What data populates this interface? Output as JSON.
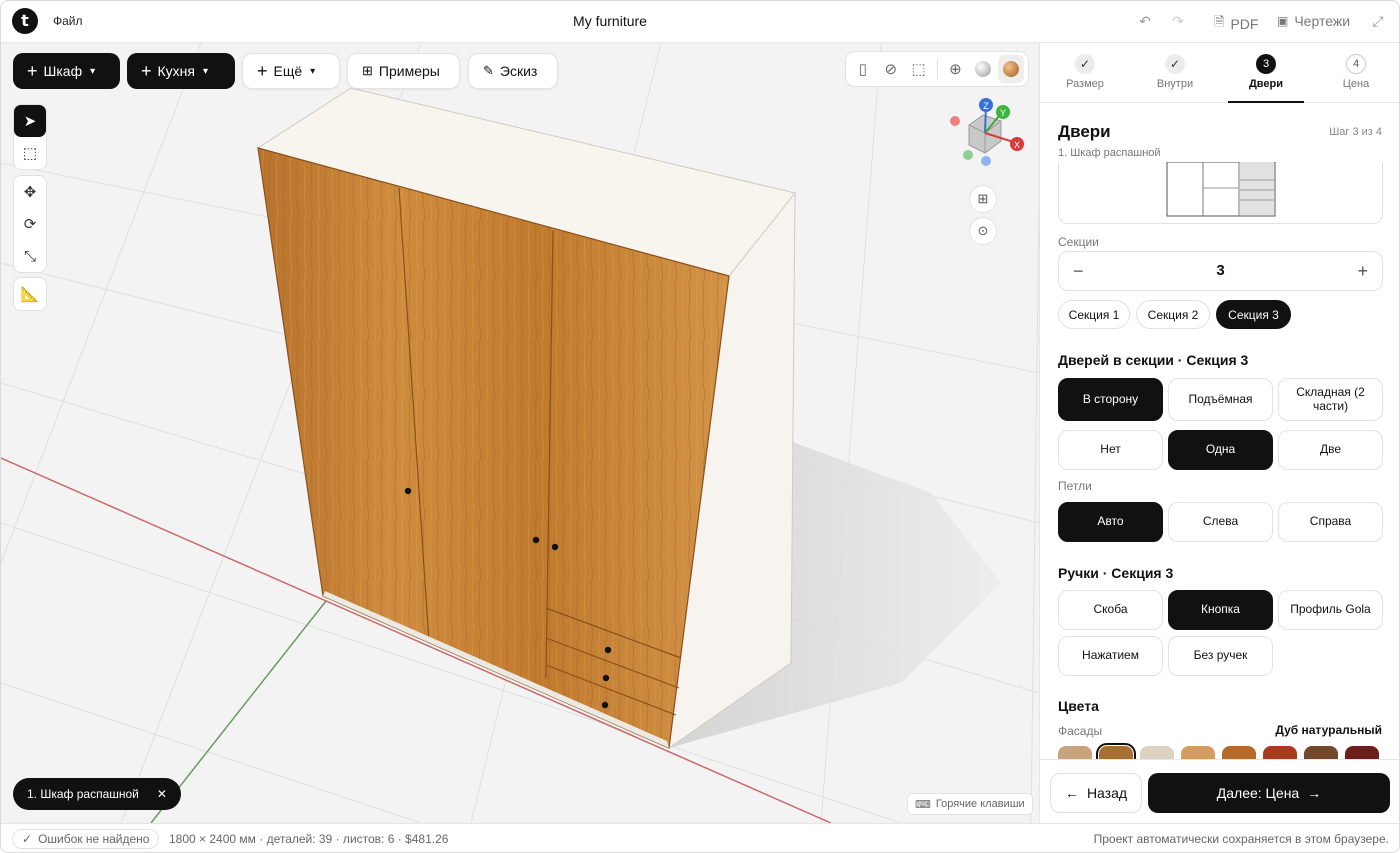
{
  "app": {
    "logo_letter": "t",
    "file_menu": "Файл",
    "title": "My furniture"
  },
  "topbar": {
    "undo_icon": "undo-icon",
    "redo_icon": "redo-icon",
    "pdf_label": "PDF",
    "drawings_label": "Чертежи",
    "fullscreen_icon": "expand-icon"
  },
  "toolbar": {
    "wardrobe": "Шкаф",
    "kitchen": "Кухня",
    "more": "Ещё",
    "examples": "Примеры",
    "sketch": "Эскиз"
  },
  "gizmo": {
    "z": "Z",
    "y": "Y",
    "x": "X"
  },
  "selection_chip": {
    "label": "1. Шкаф распашной",
    "close": "✕"
  },
  "hotkeys": "Горячие клавиши",
  "status": {
    "errors": "Ошибок не найдено",
    "info": "1800 × 2400 мм · деталей: 39 · листов: 6 · $481.26",
    "autosave": "Проект автоматически сохраняется в этом браузере."
  },
  "steps": [
    {
      "num": "✓",
      "label": "Размер",
      "state": "done"
    },
    {
      "num": "✓",
      "label": "Внутри",
      "state": "done"
    },
    {
      "num": "3",
      "label": "Двери",
      "state": "current"
    },
    {
      "num": "4",
      "label": "Цена",
      "state": "todo"
    }
  ],
  "panel": {
    "title": "Двери",
    "step_of": "Шаг 3 из 4",
    "subtitle": "1. Шкаф распашной",
    "sections_label": "Секции",
    "sections_value": "3",
    "section_pills": [
      "Секция 1",
      "Секция 2",
      "Секция 3"
    ],
    "selected_section": 2,
    "doors_heading": "Дверей в секции · Секция 3",
    "door_types": [
      "В сторону",
      "Подъёмная",
      "Складная (2 части)"
    ],
    "door_counts": [
      "Нет",
      "Одна",
      "Две"
    ],
    "hinges_label": "Петли",
    "hinges": [
      "Авто",
      "Слева",
      "Справа"
    ],
    "handles_heading": "Ручки · Секция 3",
    "handles": [
      "Скоба",
      "Кнопка",
      "Профиль Gola",
      "Нажатием",
      "Без ручек"
    ],
    "colors_heading": "Цвета",
    "facades_label": "Фасады",
    "facade_name": "Дуб натуральный",
    "swatches": [
      "#c9a27e",
      "#a86f33",
      "#ddd2c2",
      "#d69b5e",
      "#b56a2a",
      "#a83a1d",
      "#74482a",
      "#6b1e1a"
    ]
  },
  "footer": {
    "back": "Назад",
    "next": "Далее: Цена"
  },
  "colors": {
    "accent": "#111111",
    "wood": "#c07a2c"
  }
}
